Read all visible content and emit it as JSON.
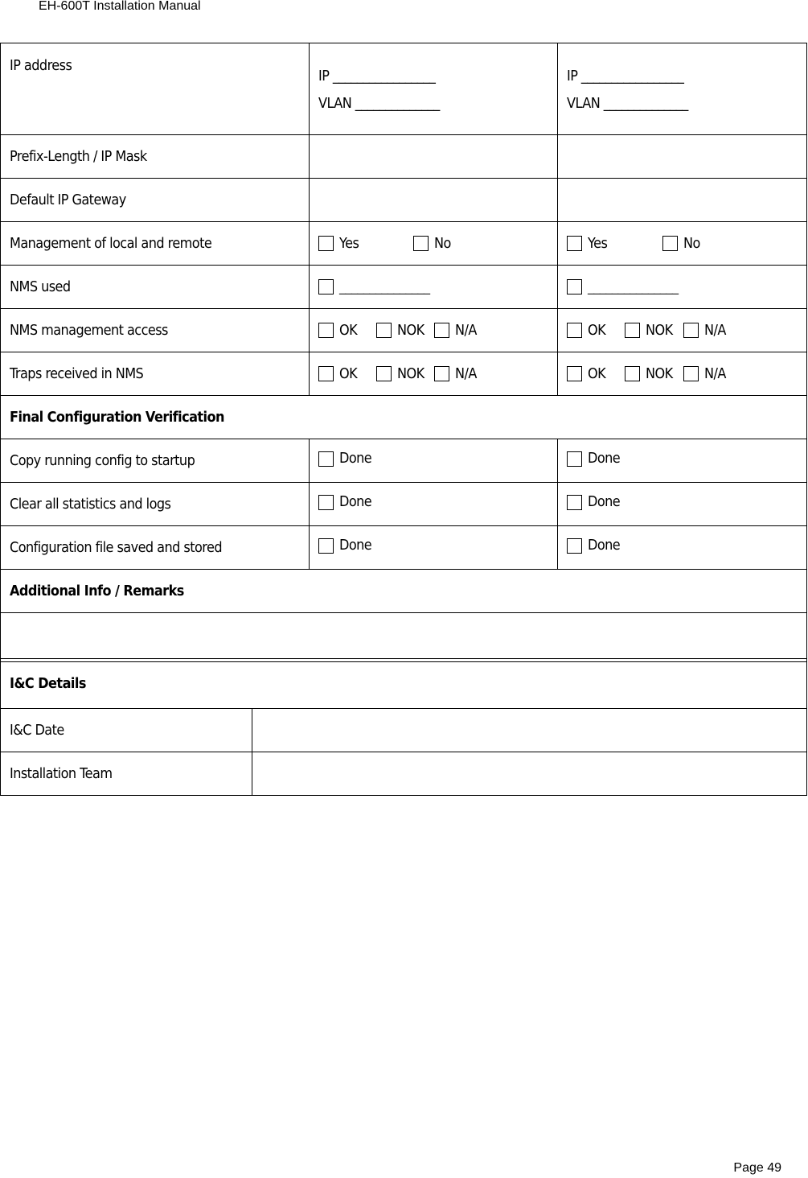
{
  "header": {
    "title": "EH-600T Installation Manual"
  },
  "footer": {
    "page": "Page 49"
  },
  "table": {
    "ip_row": {
      "label": "IP address",
      "col2": {
        "ip": "IP _________________",
        "vlan": "VLAN ______________"
      },
      "col3": {
        "ip": "IP _________________",
        "vlan": "VLAN ______________"
      }
    },
    "prefix_row": {
      "label": "Prefix-Length / IP Mask"
    },
    "gateway_row": {
      "label": "Default IP Gateway"
    },
    "management_row": {
      "label": "Management of local and remote",
      "options": [
        "Yes",
        "No"
      ]
    },
    "nms_used_row": {
      "label": "NMS used",
      "blank": "_______________"
    },
    "nms_access_row": {
      "label": "NMS management access",
      "options": [
        "OK",
        "NOK",
        "N/A"
      ]
    },
    "traps_row": {
      "label": "Traps received in NMS",
      "options": [
        "OK",
        "NOK",
        "N/A"
      ]
    },
    "final_section": {
      "title": "Final Configuration Verification"
    },
    "copy_row": {
      "label": "Copy running config to startup",
      "option": "Done"
    },
    "clear_row": {
      "label": "Clear all statistics and logs",
      "option": "Done"
    },
    "saved_row": {
      "label": "Configuration file saved and stored",
      "option": "Done"
    },
    "remarks_section": {
      "title": "Additional Info / Remarks",
      "value": ""
    },
    "ic_section": {
      "title": "I&C Details"
    },
    "ic_date_row": {
      "label": "I&C Date",
      "value": ""
    },
    "team_row": {
      "label": "Installation Team",
      "value": ""
    }
  }
}
